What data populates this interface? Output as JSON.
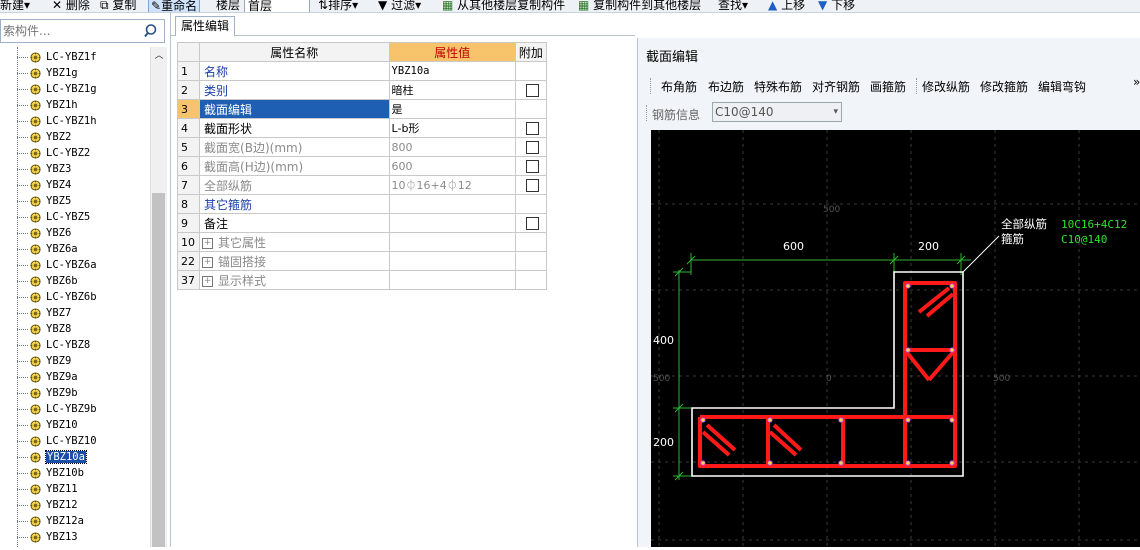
{
  "toolbar": {
    "new_label": "新建",
    "delete_label": "删除",
    "copy_label": "复制",
    "rename_label": "重命名",
    "floor_label": "楼层",
    "floor_value": "首层",
    "sort_label": "排序",
    "filter_label": "过滤",
    "copy_from_other_floor": "从其他楼层复制构件",
    "copy_to_other_floor": "复制构件到其他楼层",
    "find_label": "查找",
    "move_up_label": "上移",
    "move_down_label": "下移"
  },
  "search": {
    "placeholder": "索构件..."
  },
  "tree": {
    "items": [
      "LC-YBZ1f",
      "YBZ1g",
      "LC-YBZ1g",
      "YBZ1h",
      "LC-YBZ1h",
      "YBZ2",
      "LC-YBZ2",
      "YBZ3",
      "YBZ4",
      "YBZ5",
      "LC-YBZ5",
      "YBZ6",
      "YBZ6a",
      "LC-YBZ6a",
      "YBZ6b",
      "LC-YBZ6b",
      "YBZ7",
      "YBZ8",
      "LC-YBZ8",
      "YBZ9",
      "YBZ9a",
      "YBZ9b",
      "LC-YBZ9b",
      "YBZ10",
      "LC-YBZ10",
      "YBZ10a",
      "YBZ10b",
      "YBZ11",
      "YBZ12",
      "YBZ12a",
      "YBZ13"
    ],
    "selected": "YBZ10a"
  },
  "props": {
    "tab_label": "属性编辑",
    "col_name": "属性名称",
    "col_value": "属性值",
    "col_extra": "附加",
    "rows": [
      {
        "num": "1",
        "name": "名称",
        "value": "YBZ10a"
      },
      {
        "num": "2",
        "name": "类别",
        "value": "暗柱"
      },
      {
        "num": "3",
        "name": "截面编辑",
        "value": "是"
      },
      {
        "num": "4",
        "name": "截面形状",
        "value": "L-b形"
      },
      {
        "num": "5",
        "name": "截面宽(B边)(mm)",
        "value": "800"
      },
      {
        "num": "6",
        "name": "截面高(H边)(mm)",
        "value": "600"
      },
      {
        "num": "7",
        "name": "全部纵筋",
        "value": "10⏀16+4⏀12"
      },
      {
        "num": "8",
        "name": "其它箍筋",
        "value": ""
      },
      {
        "num": "9",
        "name": "备注",
        "value": ""
      },
      {
        "num": "10",
        "name": "其它属性",
        "value": ""
      },
      {
        "num": "22",
        "name": "锚固搭接",
        "value": ""
      },
      {
        "num": "37",
        "name": "显示样式",
        "value": ""
      }
    ]
  },
  "editor": {
    "title": "截面编辑",
    "tools": [
      "布角筋",
      "布边筋",
      "特殊布筋",
      "对齐钢筋",
      "画箍筋",
      "修改纵筋",
      "修改箍筋",
      "编辑弯钩"
    ],
    "more": "»",
    "rebar_info_label": "钢筋信息",
    "rebar_info_value": "C10@140",
    "drawing": {
      "dim_top_left": "600",
      "dim_top_right": "200",
      "dim_left_top": "400",
      "dim_left_bottom": "200",
      "grid_label_top": "500",
      "grid_label_left": "500",
      "grid_label_center": "0",
      "grid_label_right": "500",
      "legend_long_label": "全部纵筋",
      "legend_long_value": "10C16+4C12",
      "legend_stirrup_label": "箍筋",
      "legend_stirrup_value": "C10@140"
    }
  }
}
